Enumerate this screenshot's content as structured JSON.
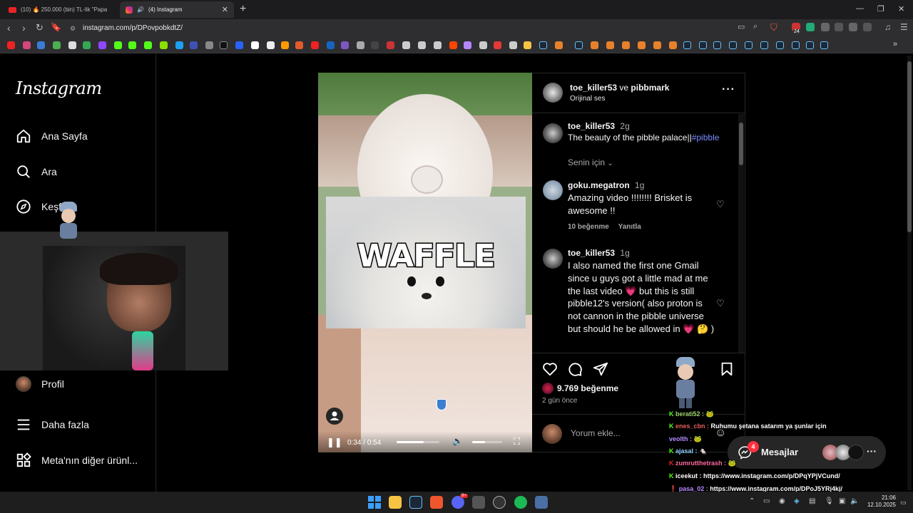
{
  "browser": {
    "tabs": [
      {
        "label": "(10) 🔥 250.000 (bin) TL-lik \"Papa",
        "active": false
      },
      {
        "label": "(4) Instagram",
        "active": true
      }
    ],
    "url": "instagram.com/p/DPovpobkdtZ/",
    "ext_badge": "24"
  },
  "sidebar": {
    "logo": "Instagram",
    "items": [
      {
        "label": "Ana Sayfa",
        "icon": "home-icon"
      },
      {
        "label": "Ara",
        "icon": "search-icon"
      },
      {
        "label": "Keşfet",
        "icon": "compass-icon"
      },
      {
        "label": "Profil",
        "icon": "avatar"
      },
      {
        "label": "Daha fazla",
        "icon": "menu-icon"
      },
      {
        "label": "Meta'nın diğer ürünl...",
        "icon": "apps-icon"
      }
    ]
  },
  "post": {
    "header": {
      "user1": "toe_killer53",
      "conj": "ve",
      "user2": "pibbmark",
      "audio": "Orijinal ses"
    },
    "caption": {
      "user": "toe_killer53",
      "time": "2g",
      "text": "The beauty of the pibble palace||",
      "hashtag": "#pibble"
    },
    "for_you": "Senin için",
    "comments": [
      {
        "user": "goku.megatron",
        "time": "1g",
        "text": "Amazing video !!!!!!!! Brisket is awesome !!",
        "likes": "10 beğenme",
        "reply": "Yanıtla"
      },
      {
        "user": "toe_killer53",
        "time": "1g",
        "text": "I also named the first one Gmail since u guys got a little mad at me the last video 💗 but this is still pibble12's version( also proton is not cannon in the pibble universe but should he be allowed in 💗 🤔 )"
      }
    ],
    "likes": "9.769 beğenme",
    "posted": "2 gün önce",
    "comment_placeholder": "Yorum ekle...",
    "video": {
      "overlay_text": "WAFFLE",
      "time": "0:34 / 0:54",
      "progress": 0.63
    }
  },
  "messages": {
    "label": "Mesajlar",
    "badge": "4"
  },
  "chat": [
    {
      "user": "berati52 :",
      "msg": "🐸",
      "color": "#9fd36a"
    },
    {
      "user": "enes_cbn :",
      "msg": "Ruhumu şetana satarım ya şunlar için",
      "color": "#e85c5c"
    },
    {
      "user": "veolth :",
      "msg": "🐸",
      "color": "#b58bff"
    },
    {
      "user": "ajasal :",
      "msg": "🐁",
      "color": "#8fd0ff"
    },
    {
      "user": "zumrutthetrash :",
      "msg": "🐸",
      "color": "#ff6aa2"
    },
    {
      "user": "iceekut :",
      "msg": "https://www.instagram.com/p/DPqYPjVCund/",
      "color": "#ffffff"
    },
    {
      "user": "pasa_02 :",
      "msg": "https://www.instagram.com/p/DPoJ5YRj4kj/",
      "color": "#b58bff"
    }
  ],
  "taskbar": {
    "time": "21:06",
    "date": "12.10.2025",
    "discord_badge": "9+"
  }
}
